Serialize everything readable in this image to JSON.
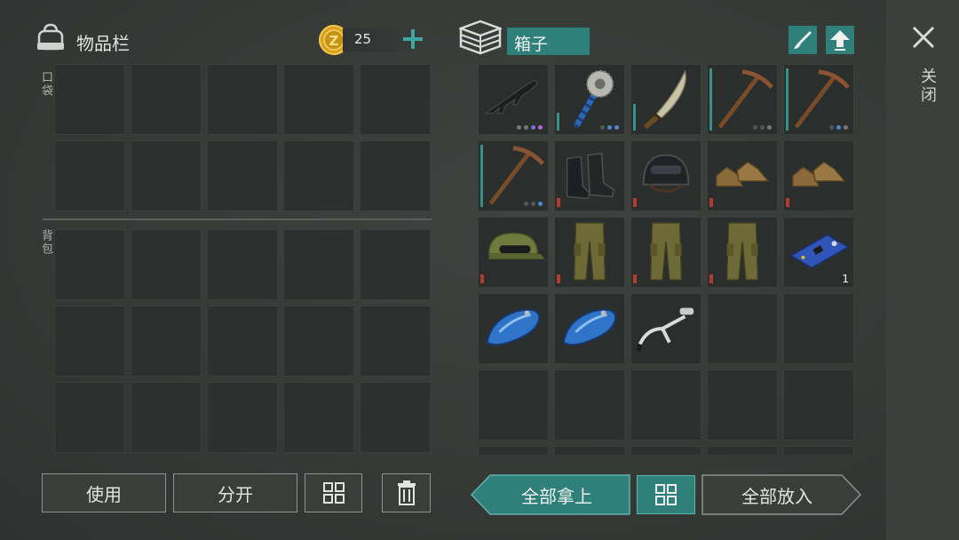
{
  "inventory": {
    "title": "物品栏",
    "pocket_label": "口袋",
    "backpack_label": "背包",
    "coins": "25"
  },
  "container": {
    "title": "箱子",
    "close_label": "关闭"
  },
  "buttons": {
    "use": "使用",
    "split": "分开",
    "take_all": "全部拿上",
    "put_all": "全部放入"
  },
  "container_items": [
    {
      "name": "assault-rifle",
      "dots": [
        "#777",
        "#777",
        "#7a6fd0",
        "#b06ad6"
      ]
    },
    {
      "name": "sawblade-mace",
      "dots": [
        "#555",
        "#4f87d1",
        "#4f87d1"
      ]
    },
    {
      "name": "machete",
      "dots": []
    },
    {
      "name": "pickaxe",
      "dots": [
        "#555",
        "#555",
        "#777"
      ]
    },
    {
      "name": "pickaxe",
      "dots": [
        "#555",
        "#4f87d1",
        "#777"
      ]
    },
    {
      "name": "pickaxe",
      "dots": [
        "#555",
        "#555",
        "#4f87d1"
      ]
    },
    {
      "name": "combat-boots",
      "dots": []
    },
    {
      "name": "combat-helmet",
      "dots": []
    },
    {
      "name": "leather-shoes",
      "dots": []
    },
    {
      "name": "leather-shoes",
      "dots": []
    },
    {
      "name": "camo-cap",
      "dots": []
    },
    {
      "name": "camo-pants",
      "dots": []
    },
    {
      "name": "camo-pants",
      "dots": []
    },
    {
      "name": "camo-pants",
      "dots": []
    },
    {
      "name": "circuit-board",
      "qty": "1"
    },
    {
      "name": "fuel-tank"
    },
    {
      "name": "fuel-tank"
    },
    {
      "name": "handlebar"
    }
  ],
  "colors": {
    "accent_teal": "#2f7f7b",
    "coin_gold": "#d8a21c"
  }
}
